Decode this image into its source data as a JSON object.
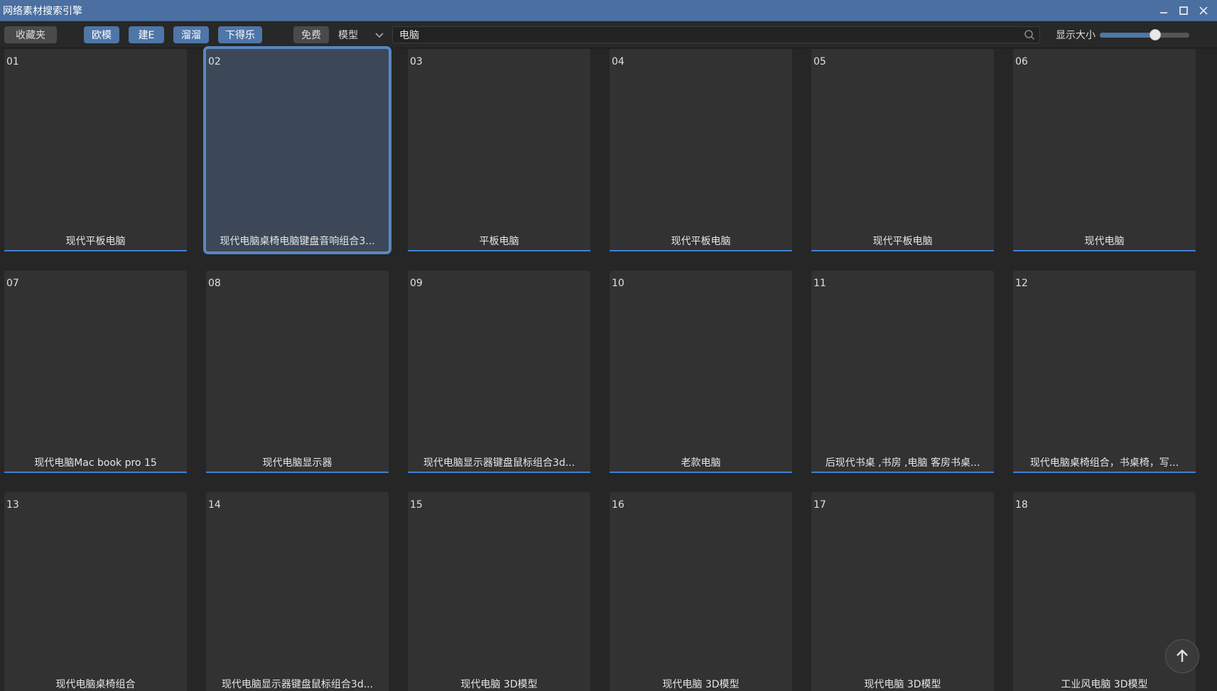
{
  "window": {
    "title": "网络素材搜索引擎"
  },
  "toolbar": {
    "favorites_label": "收藏夹",
    "sources": [
      "欧模",
      "建E",
      "溜溜",
      "下得乐"
    ],
    "free_label": "免费",
    "type_selected": "模型",
    "search_value": "电脑",
    "size_label": "显示大小",
    "size_slider_value": 0.62
  },
  "colors": {
    "titlebar": "#4a6fa0",
    "accent": "#4e76a8",
    "selected_outline": "#5b87c0",
    "underline": "#3d7fd6"
  },
  "selected_index": 1,
  "items": [
    {
      "num": "01",
      "caption": "现代平板电脑"
    },
    {
      "num": "02",
      "caption": "现代电脑桌椅电脑键盘音响组合3..."
    },
    {
      "num": "03",
      "caption": "平板电脑"
    },
    {
      "num": "04",
      "caption": "现代平板电脑"
    },
    {
      "num": "05",
      "caption": "现代平板电脑"
    },
    {
      "num": "06",
      "caption": "现代电脑"
    },
    {
      "num": "07",
      "caption": "现代电脑Mac book pro 15"
    },
    {
      "num": "08",
      "caption": "现代电脑显示器"
    },
    {
      "num": "09",
      "caption": "现代电脑显示器键盘鼠标组合3d..."
    },
    {
      "num": "10",
      "caption": "老款电脑"
    },
    {
      "num": "11",
      "caption": "后现代书桌 ,书房 ,电脑 客房书桌..."
    },
    {
      "num": "12",
      "caption": "现代电脑桌椅组合，书桌椅，写..."
    },
    {
      "num": "13",
      "caption": "现代电脑桌椅组合"
    },
    {
      "num": "14",
      "caption": "现代电脑显示器键盘鼠标组合3d..."
    },
    {
      "num": "15",
      "caption": "现代电脑 3D模型"
    },
    {
      "num": "16",
      "caption": "现代电脑 3D模型"
    },
    {
      "num": "17",
      "caption": "现代电脑 3D模型"
    },
    {
      "num": "18",
      "caption": "工业风电脑 3D模型"
    }
  ],
  "icons": {
    "minimize": "minimize-icon",
    "maximize": "maximize-icon",
    "close": "close-icon",
    "dropdown": "chevron-down-icon",
    "search": "search-icon",
    "scroll_top": "arrow-up-icon"
  }
}
